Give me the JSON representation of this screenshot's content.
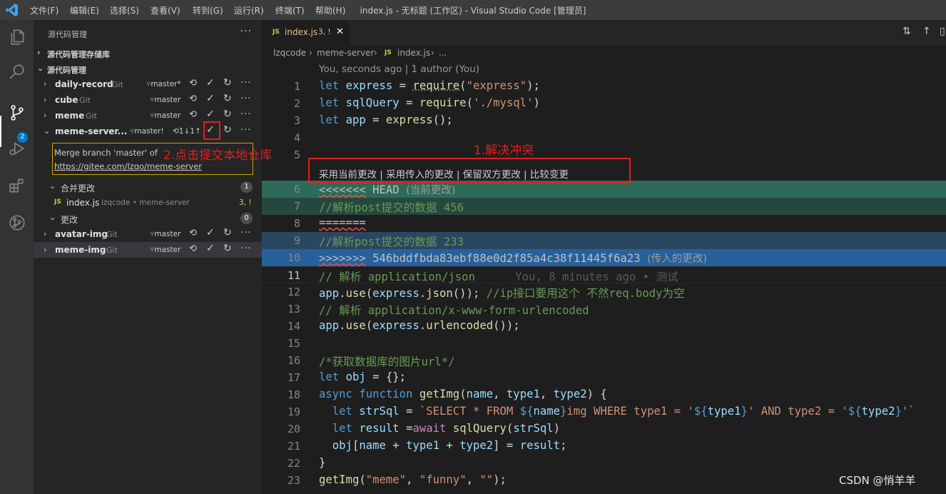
{
  "titlebar": {
    "menus": [
      "文件(F)",
      "编辑(E)",
      "选择(S)",
      "查看(V)",
      "转到(G)",
      "运行(R)",
      "终端(T)",
      "帮助(H)"
    ],
    "window_title": "index.js - 无标题 (工作区) - Visual Studio Code [管理员]"
  },
  "activitybar": {
    "icons": [
      "explorer-icon",
      "search-icon",
      "source-control-icon",
      "run-debug-icon",
      "extensions-icon",
      "git-graph-icon"
    ],
    "scm_badge": "2",
    "active": "source-control-icon"
  },
  "sidebar": {
    "title": "源代码管理",
    "more": "···",
    "repos_section": "源代码管理存储库",
    "scm_section": "源代码管理",
    "repos": [
      {
        "name": "daily-record",
        "provider": "Git",
        "branch": "master*"
      },
      {
        "name": "cube",
        "provider": "Git",
        "branch": "master"
      },
      {
        "name": "meme",
        "provider": "Git",
        "branch": "master"
      },
      {
        "name": "meme-server...",
        "provider": "",
        "branch": "master!",
        "sync": "⟲1↓1↑"
      },
      {
        "name": "avatar-img",
        "provider": "Git",
        "branch": "master"
      },
      {
        "name": "meme-img",
        "provider": "Git",
        "branch": "master"
      }
    ],
    "tooltip": {
      "line1": "Merge branch 'master' of",
      "line2": "https://gitee.com/lzqo/meme-server"
    },
    "merge_group": {
      "label": "合并更改",
      "count": "1"
    },
    "merge_file": {
      "name": "index.js",
      "path": "lzqcode • meme-server",
      "status": "3, !"
    },
    "changes_group": {
      "label": "更改",
      "count": "0"
    }
  },
  "tabs": [
    {
      "name": "index.js",
      "status": "3, !",
      "close": "✕"
    }
  ],
  "breadcrumb": [
    "lzqcode",
    "›",
    "meme-server",
    "›",
    "index.js",
    "›",
    "..."
  ],
  "editor": {
    "blame_lens": "You, seconds ago | 1 author (You)",
    "conflict_actions": "采用当前更改 | 采用传入的更改 | 保留双方更改 | 比较变更",
    "current_note": "(当前更改)",
    "incoming_note": "(传入的更改)",
    "line_blame": "You, 8 minutes ago • 测试",
    "line_numbers": [
      "1",
      "2",
      "3",
      "4",
      "5",
      "6",
      "7",
      "8",
      "9",
      "10",
      "11",
      "12",
      "13",
      "14",
      "15",
      "16",
      "17",
      "18",
      "19",
      "20",
      "21",
      "22",
      "23"
    ],
    "current_line": "11"
  },
  "annotations": {
    "step1": "1.解决冲突",
    "step2": "2.点击提交本地仓库"
  },
  "watermark": "CSDN @悄羊羊",
  "colors": {
    "accent": "#007acc",
    "annotation_red": "#e02020",
    "current_change_header": "#2d6a5a",
    "current_change_body": "#25483e",
    "incoming_change_body": "#2a4762",
    "incoming_change_header": "#27609b"
  }
}
